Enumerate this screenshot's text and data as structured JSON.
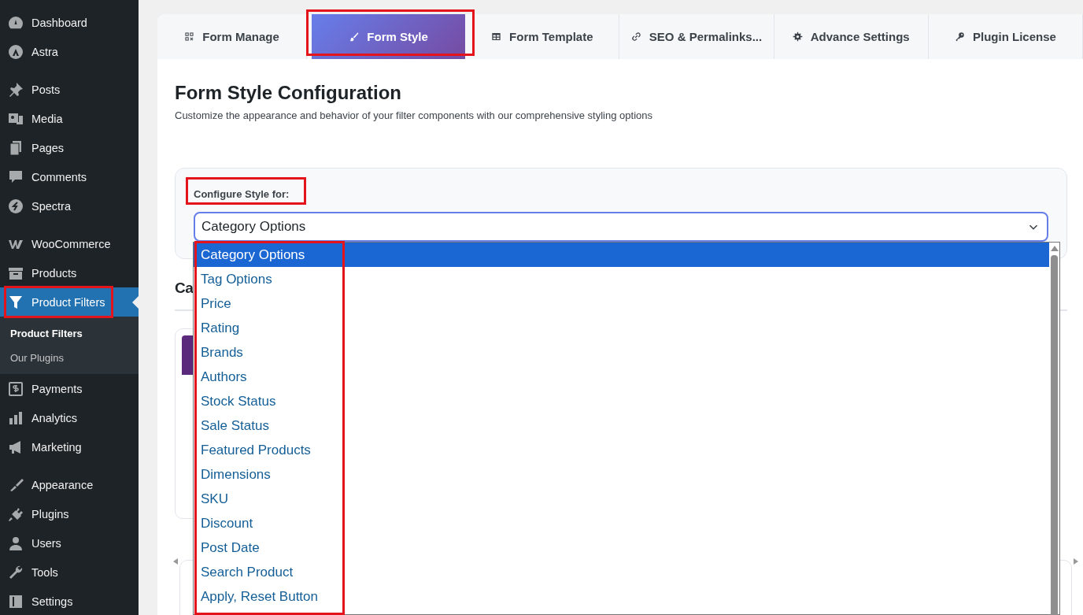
{
  "sidebar": {
    "groups": [
      {
        "items": [
          {
            "label": "Dashboard",
            "current": false
          },
          {
            "label": "Astra",
            "current": false
          }
        ]
      },
      {
        "items": [
          {
            "label": "Posts",
            "current": false
          },
          {
            "label": "Media",
            "current": false
          },
          {
            "label": "Pages",
            "current": false
          },
          {
            "label": "Comments",
            "current": false
          },
          {
            "label": "Spectra",
            "current": false
          }
        ]
      },
      {
        "items": [
          {
            "label": "WooCommerce",
            "current": false
          },
          {
            "label": "Products",
            "current": false
          },
          {
            "label": "Product Filters",
            "current": true,
            "children": [
              {
                "label": "Product Filters",
                "selected": true
              },
              {
                "label": "Our Plugins",
                "selected": false
              }
            ]
          },
          {
            "label": "Payments",
            "current": false
          },
          {
            "label": "Analytics",
            "current": false
          },
          {
            "label": "Marketing",
            "current": false
          }
        ]
      },
      {
        "items": [
          {
            "label": "Appearance",
            "current": false
          },
          {
            "label": "Plugins",
            "current": false
          },
          {
            "label": "Users",
            "current": false
          },
          {
            "label": "Tools",
            "current": false
          },
          {
            "label": "Settings",
            "current": false
          }
        ]
      }
    ]
  },
  "tabs": [
    {
      "label": "Form Manage",
      "selected": false
    },
    {
      "label": "Form Style",
      "selected": true
    },
    {
      "label": "Form Template",
      "selected": false
    },
    {
      "label": "SEO & Permalinks...",
      "selected": false
    },
    {
      "label": "Advance Settings",
      "selected": false
    },
    {
      "label": "Plugin License",
      "selected": false
    }
  ],
  "page": {
    "title": "Form Style Configuration",
    "subtitle": "Customize the appearance and behavior of your filter components with our comprehensive styling options"
  },
  "style_picker": {
    "label": "Configure Style for:",
    "value": "Category Options",
    "expanded": true,
    "options": [
      {
        "label": "Category Options",
        "selected": true
      },
      {
        "label": "Tag Options",
        "selected": false
      },
      {
        "label": "Price",
        "selected": false
      },
      {
        "label": "Rating",
        "selected": false
      },
      {
        "label": "Brands",
        "selected": false
      },
      {
        "label": "Authors",
        "selected": false
      },
      {
        "label": "Stock Status",
        "selected": false
      },
      {
        "label": "Sale Status",
        "selected": false
      },
      {
        "label": "Featured Products",
        "selected": false
      },
      {
        "label": "Dimensions",
        "selected": false
      },
      {
        "label": "SKU",
        "selected": false
      },
      {
        "label": "Discount",
        "selected": false
      },
      {
        "label": "Post Date",
        "selected": false
      },
      {
        "label": "Search Product",
        "selected": false
      },
      {
        "label": "Apply, Reset Button",
        "selected": false
      }
    ]
  },
  "section": {
    "title": "Ca"
  }
}
